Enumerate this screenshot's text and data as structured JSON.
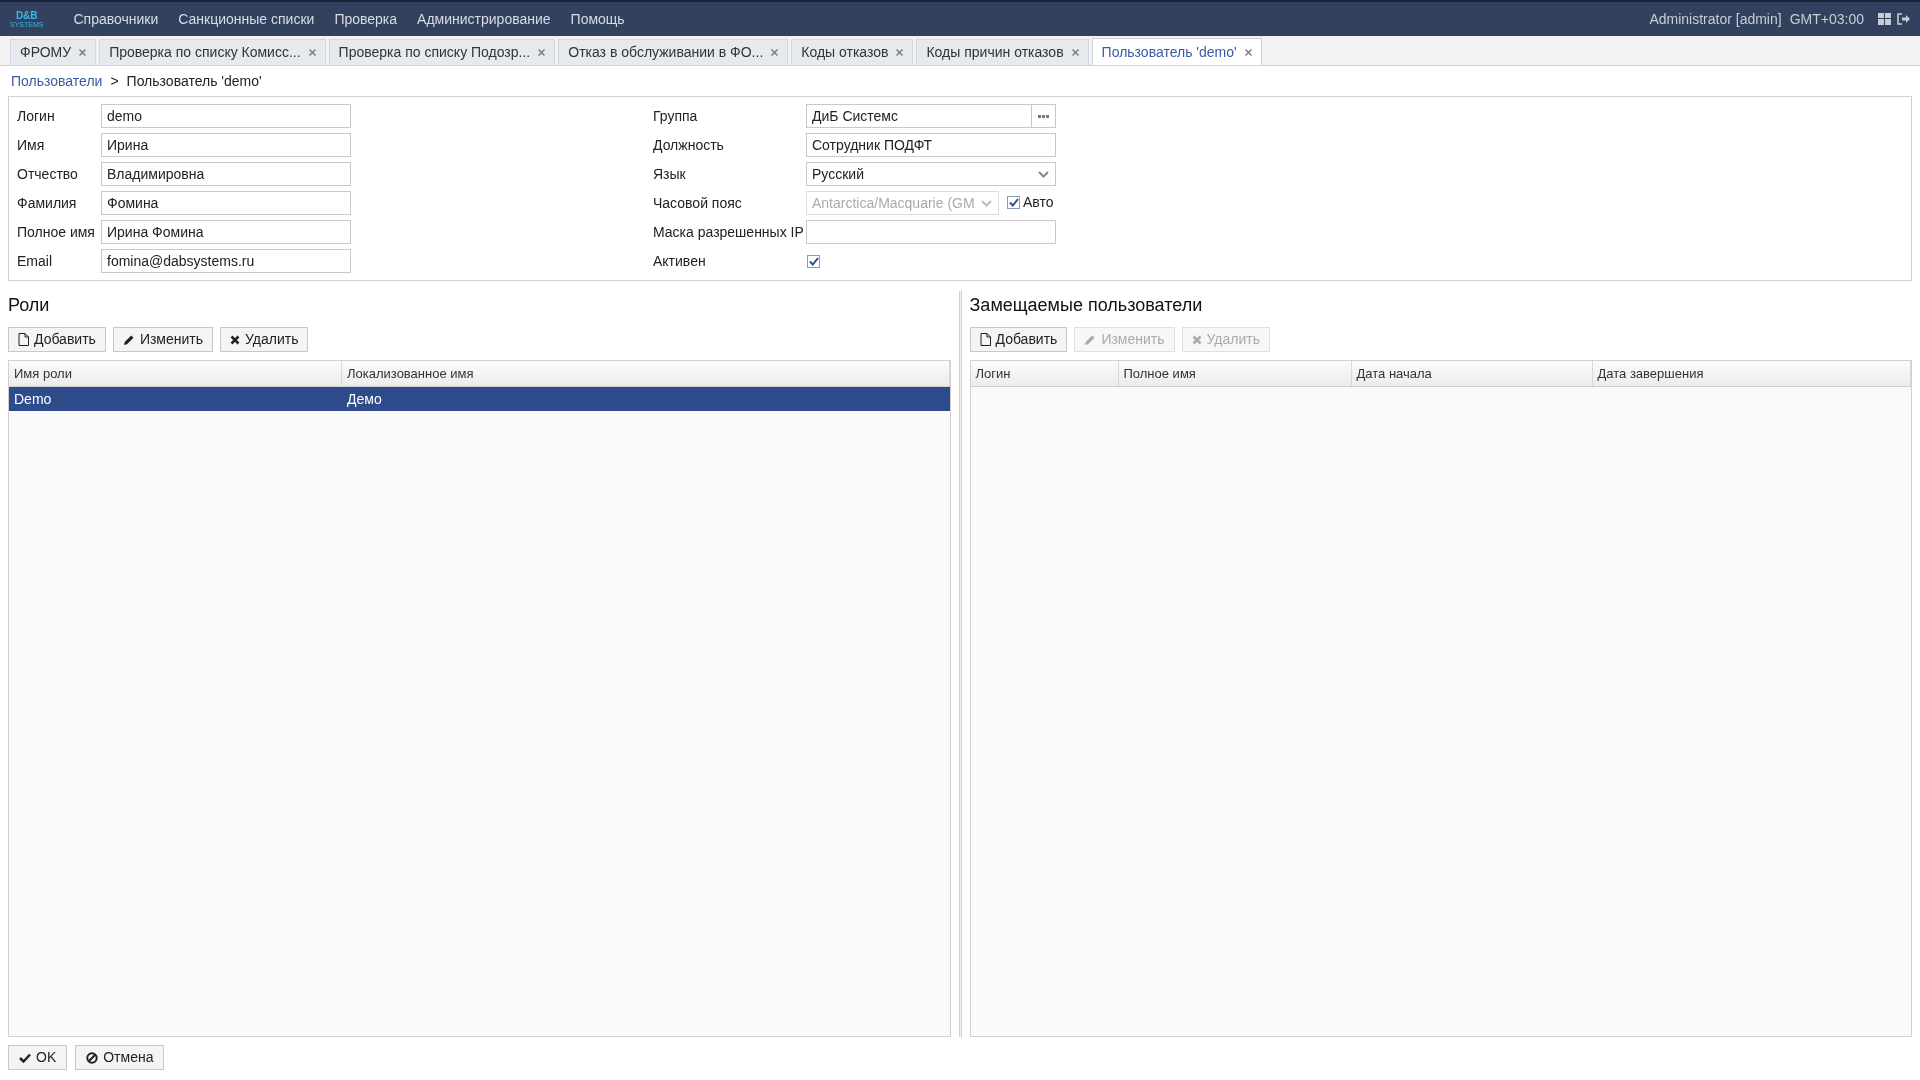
{
  "menu": {
    "logo": "D&B",
    "logo_sub": "SYSTEMS",
    "items": [
      "Справочники",
      "Санкционные списки",
      "Проверка",
      "Администрирование",
      "Помощь"
    ],
    "user": "Administrator [admin]",
    "timezone": "GMT+03:00"
  },
  "tabs": [
    {
      "label": "ФРОМУ",
      "selected": false
    },
    {
      "label": "Проверка по списку Комисс...",
      "selected": false
    },
    {
      "label": "Проверка по списку Подозр...",
      "selected": false
    },
    {
      "label": "Отказ в обслуживании в ФО...",
      "selected": false
    },
    {
      "label": "Коды отказов",
      "selected": false
    },
    {
      "label": "Коды причин отказов",
      "selected": false
    },
    {
      "label": "Пользователь 'demo'",
      "selected": true
    }
  ],
  "breadcrumb": {
    "link": "Пользователи",
    "separator": ">",
    "current": "Пользователь 'demo'"
  },
  "form_left": [
    {
      "label": "Логин",
      "value": "demo"
    },
    {
      "label": "Имя",
      "value": "Ирина"
    },
    {
      "label": "Отчество",
      "value": "Владимировна"
    },
    {
      "label": "Фамилия",
      "value": "Фомина"
    },
    {
      "label": "Полное имя",
      "value": "Ирина Фомина"
    },
    {
      "label": "Email",
      "value": "fomina@dabsystems.ru"
    }
  ],
  "form_right": [
    {
      "kind": "lookup",
      "label": "Группа",
      "value": "ДиБ Системс"
    },
    {
      "kind": "text",
      "label": "Должность",
      "value": "Сотрудник ПОДФТ"
    },
    {
      "kind": "select",
      "label": "Язык",
      "value": "Русский",
      "disabled": false
    },
    {
      "kind": "select",
      "label": "Часовой пояс",
      "value": "Antarctica/Macquarie (GM",
      "disabled": true,
      "auto": {
        "label": "Авто",
        "checked": true
      }
    },
    {
      "kind": "text",
      "label": "Маска разрешенных IP"
    },
    {
      "kind": "checkbox",
      "label": "Активен",
      "checked": true
    }
  ],
  "roles": {
    "title": "Роли",
    "buttons": [
      {
        "kind": "add",
        "label": "Добавить",
        "disabled": false
      },
      {
        "kind": "edit",
        "label": "Изменить",
        "disabled": false
      },
      {
        "kind": "delete",
        "label": "Удалить",
        "disabled": false
      }
    ],
    "columns": [
      "Имя роли",
      "Локализованное имя"
    ],
    "rows": [
      {
        "cells": [
          "Demo",
          "Демо"
        ],
        "selected": true
      }
    ]
  },
  "substitutes": {
    "title": "Замещаемые пользователи",
    "buttons": [
      {
        "kind": "add",
        "label": "Добавить",
        "disabled": false
      },
      {
        "kind": "edit",
        "label": "Изменить",
        "disabled": true
      },
      {
        "kind": "delete",
        "label": "Удалить",
        "disabled": true
      }
    ],
    "columns": [
      "Логин",
      "Полное имя",
      "Дата начала",
      "Дата завершения"
    ]
  },
  "footer": [
    {
      "kind": "ok",
      "label": "OK"
    },
    {
      "kind": "cancel",
      "label": "Отмена"
    }
  ]
}
